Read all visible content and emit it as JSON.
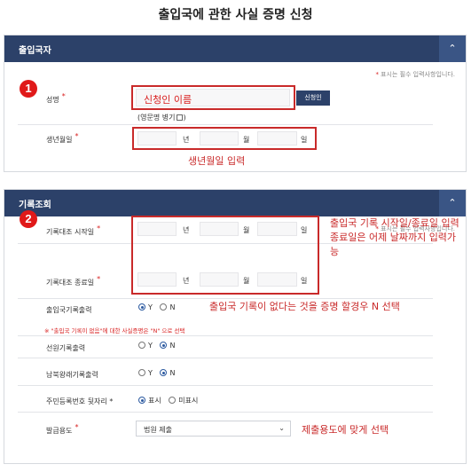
{
  "page_title": "출입국에 관한 사실 증명 신청",
  "required_note": "표시는 필수 입력사항입니다.",
  "section1": {
    "title": "출입국자",
    "collapse_icon": "chevron-up-icon",
    "badge": "1",
    "name_label": "성명",
    "name_value": "신청인 이름",
    "name_button": "신청인",
    "english_label": "(영문명 병기",
    "english_suffix": ")",
    "birth_label": "생년월일",
    "unit_year": "년",
    "unit_month": "월",
    "unit_day": "일",
    "birth_note": "생년월일 입력"
  },
  "section2": {
    "title": "기록조회",
    "collapse_icon": "chevron-up-icon",
    "badge": "2",
    "start_label": "기록대조 시작일",
    "end_label": "기록대조 종료일",
    "unit_year": "년",
    "unit_month": "월",
    "unit_day": "일",
    "date_note": "출입국 기록 시작일/종료일 입력 종료일은 어제 날짜까지 입력가능",
    "output_label": "출입국기록출력",
    "output_options": [
      "Y",
      "N"
    ],
    "output_selected": "Y",
    "output_note": "출입국 기록이 없다는 것을 증명 할경우 N 선택",
    "warning": "※ \"출입국 기록이 없음\"에 대한 사실증명은 \"N\" 으로 선택",
    "crew_label": "선원기록출력",
    "crew_options": [
      "Y",
      "N"
    ],
    "crew_selected": "N",
    "nk_label": "남북왕래기록출력",
    "nk_options": [
      "Y",
      "N"
    ],
    "nk_selected": "N",
    "rrn_label": "주민등록번호 뒷자리 *",
    "rrn_options": [
      "표시",
      "미표시"
    ],
    "rrn_selected": "표시",
    "purpose_label": "발급용도",
    "purpose_value": "법원 제출",
    "purpose_note": "제출용도에 맞게 선택"
  }
}
